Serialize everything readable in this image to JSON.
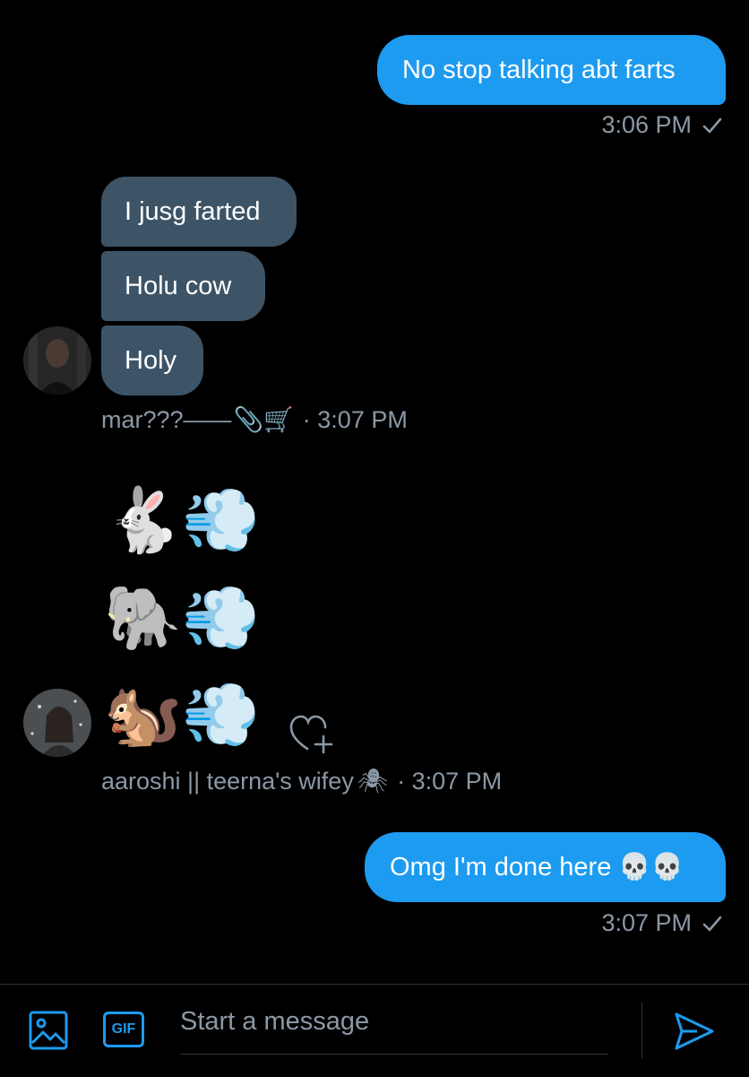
{
  "messages": {
    "outgoing_1": {
      "text": "No stop talking abt farts",
      "time": "3:06 PM"
    },
    "incoming_group_1": {
      "lines": [
        "I jusg farted",
        "Holu cow",
        "Holy"
      ],
      "sender": "mar???——",
      "sender_emoji": "📎🛒",
      "time": "· 3:07 PM"
    },
    "incoming_group_2": {
      "rows": [
        "🐇💨",
        "🐘💨",
        "🐿️💨"
      ],
      "sender": "aaroshi || teerna's wifey",
      "sender_emoji": "🕷",
      "time": "· 3:07 PM"
    },
    "outgoing_2": {
      "text": "Omg I'm done here 💀💀",
      "time": "3:07 PM"
    }
  },
  "composer": {
    "placeholder": "Start a message",
    "gif_label": "GIF"
  },
  "colors": {
    "accent": "#1d9bf0",
    "incoming_bubble": "#3d5466",
    "meta_text": "#8b98a5"
  }
}
